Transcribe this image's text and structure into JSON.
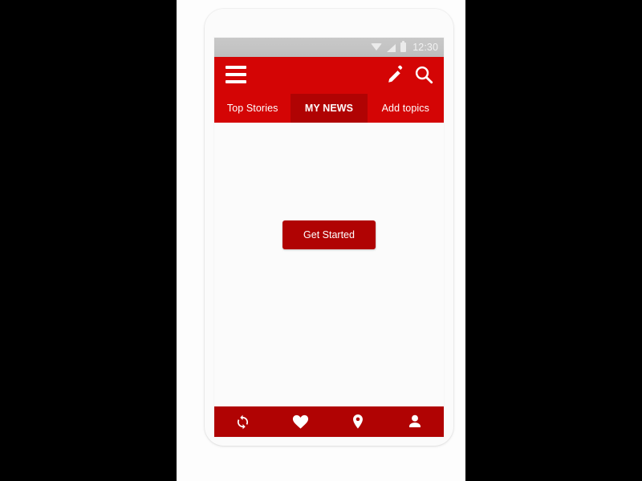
{
  "theme": {
    "primary_red": "#d40505",
    "dark_red": "#b00303",
    "status_bar_gray": "#c4c4c4",
    "screen_background": "#fbfbfb",
    "icon_white": "#ffffff",
    "canvas_black": "#000000"
  },
  "status_bar": {
    "time": "12:30",
    "icons": [
      "wifi-icon",
      "signal-icon",
      "battery-icon"
    ]
  },
  "header": {
    "menu_icon": "hamburger-menu-icon",
    "actions": [
      {
        "name": "edit-icon",
        "label": "Edit"
      },
      {
        "name": "search-icon",
        "label": "Search"
      }
    ]
  },
  "tabs": [
    {
      "label": "Top Stories",
      "active": false
    },
    {
      "label": "MY NEWS",
      "active": true
    },
    {
      "label": "Add topics",
      "active": false
    }
  ],
  "content": {
    "get_started_label": "Get Started"
  },
  "bottom_nav": [
    {
      "icon": "refresh-sync-icon",
      "label": "Sync"
    },
    {
      "icon": "heart-icon",
      "label": "Favorites"
    },
    {
      "icon": "location-pin-icon",
      "label": "Local"
    },
    {
      "icon": "person-icon",
      "label": "Profile"
    }
  ]
}
